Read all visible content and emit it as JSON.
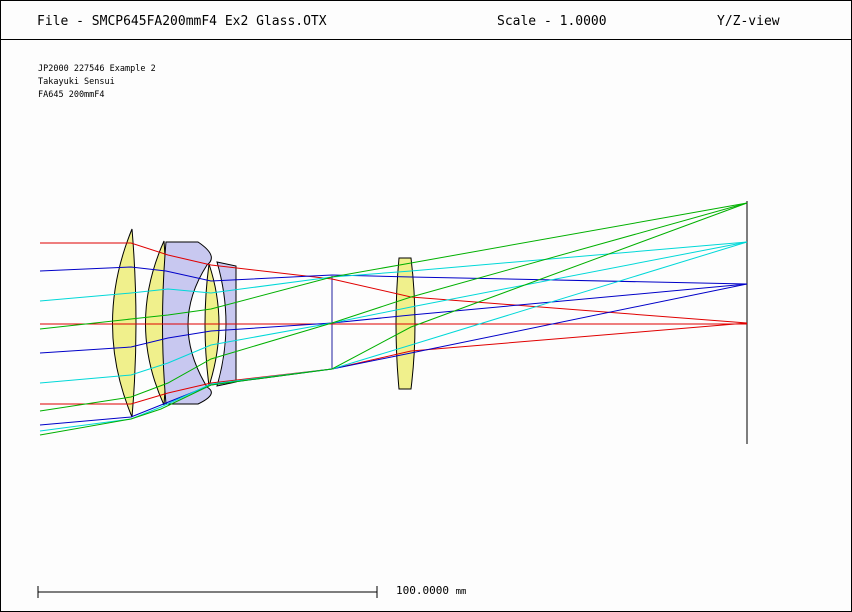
{
  "header": {
    "file_title": "File - SMCP645FA200mmF4 Ex2 Glass.OTX",
    "scale": "Scale - 1.0000",
    "view": "Y/Z-view"
  },
  "info": {
    "line1": "JP2000 227546 Example 2",
    "line2": "Takayuki Sensui",
    "line3": "FA645 200mmF4"
  },
  "scalebar": {
    "value": "100.0000",
    "unit": "mm"
  },
  "colors": {
    "ray_axial": "#e00000",
    "ray_field1": "#0000c8",
    "ray_field2": "#00e0e0",
    "ray_field3": "#00b000",
    "glass_yellow": "#f0f08c",
    "glass_lavender": "#c8c8f0"
  }
}
